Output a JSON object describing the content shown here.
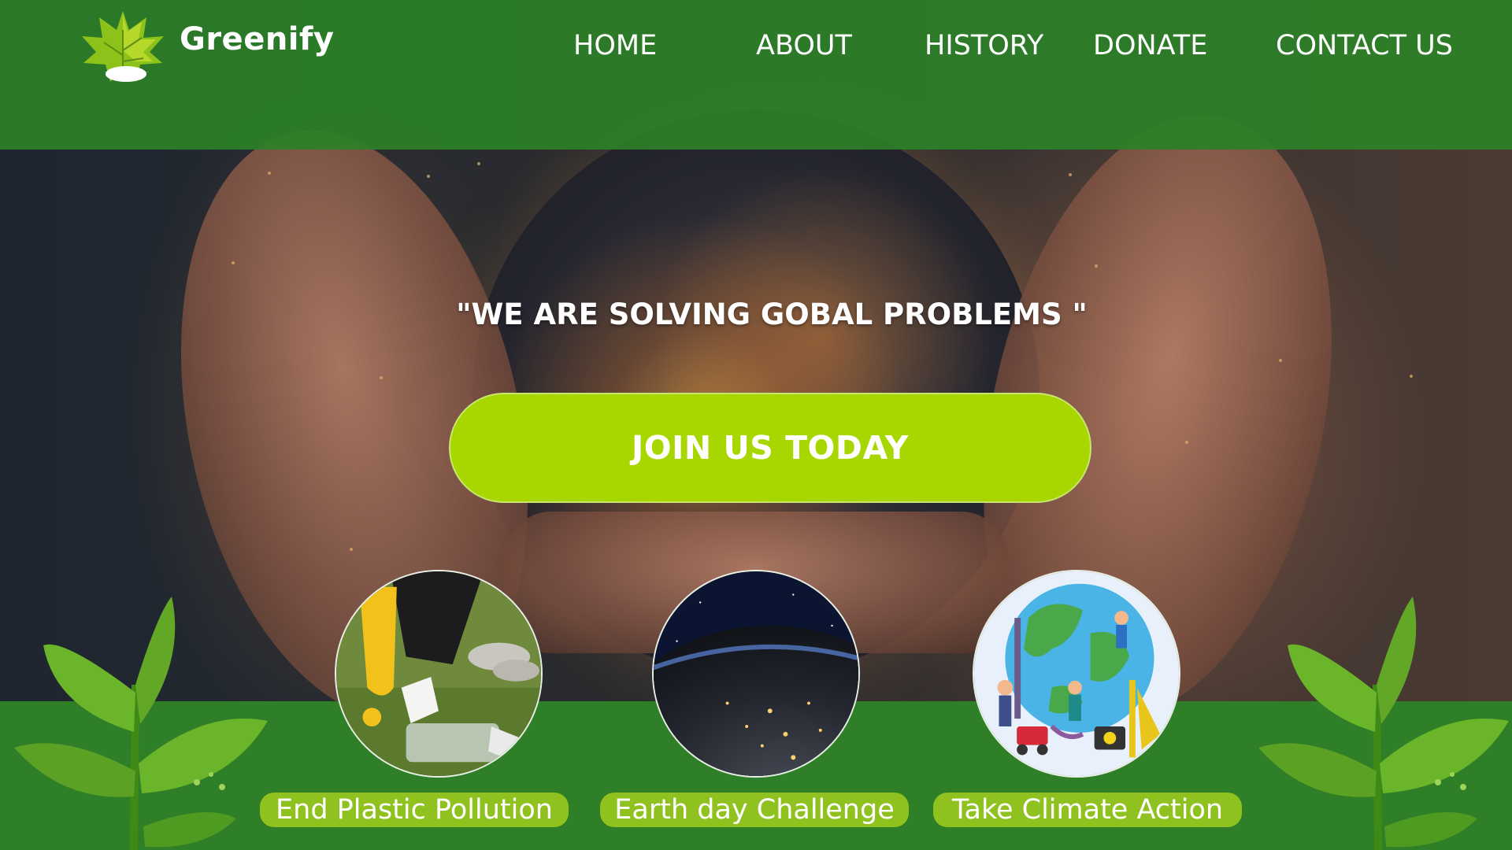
{
  "brand": {
    "name": "Greenify",
    "logo_icon": "leaf-logo-icon"
  },
  "nav": {
    "items": [
      {
        "label": "HOME"
      },
      {
        "label": "ABOUT"
      },
      {
        "label": "HISTORY"
      },
      {
        "label": "DONATE"
      },
      {
        "label": "CONTACT US"
      }
    ]
  },
  "hero": {
    "tagline": "\"WE ARE SOLVING GOBAL PROBLEMS \"",
    "cta_label": "JOIN US TODAY"
  },
  "cards": [
    {
      "label": "End Plastic Pollution",
      "image_icon": "plastic-cleanup-image"
    },
    {
      "label": "Earth day Challenge",
      "image_icon": "earth-at-night-image"
    },
    {
      "label": "Take Climate Action",
      "image_icon": "climate-action-illustration"
    }
  ],
  "colors": {
    "header_green": "#2c8028",
    "cta_lime": "#a8d600",
    "card_label_green": "#8fc21f",
    "band_green": "#2f7e28"
  }
}
